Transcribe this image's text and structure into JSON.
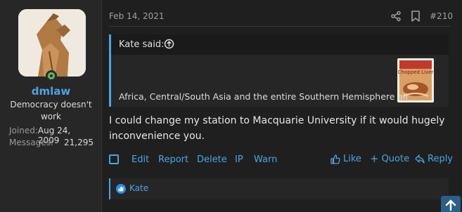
{
  "user": {
    "name": "dmlaw",
    "title": "Democracy doesn't work",
    "stats": [
      {
        "key": "Joined:",
        "value": "Aug 24, 2009"
      },
      {
        "key": "Messages:",
        "value": "21,295"
      }
    ]
  },
  "post": {
    "date": "Feb 14, 2021",
    "number": "#210",
    "quote": {
      "author": "Kate said:",
      "text": "Africa, Central/South Asia and the entire Southern Hemisphere all",
      "thumb_label": "Chopped Liver"
    },
    "body": "I could change my station to Macquarie University if it would hugely inconvenience you."
  },
  "actions": {
    "left": [
      "Edit",
      "Report",
      "Delete",
      "IP",
      "Warn"
    ],
    "like": "Like",
    "quote": "Quote",
    "reply": "Reply"
  },
  "reactions": {
    "users": "Kate"
  },
  "colors": {
    "accent": "#4ea3e3",
    "online": "#5cb85c",
    "background": "#1f1f1f"
  }
}
